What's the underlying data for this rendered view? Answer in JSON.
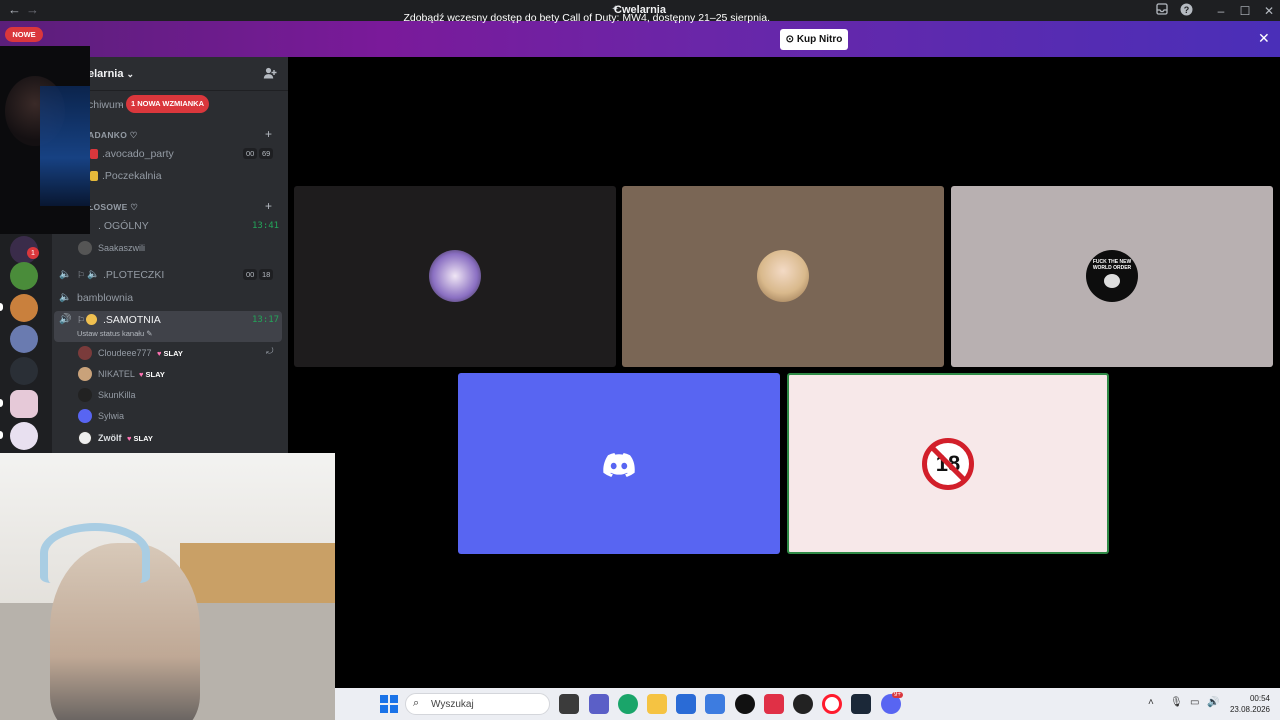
{
  "window": {
    "title": "Cwelarnia",
    "back_glyph": "←",
    "forward_glyph": "→",
    "icons": [
      "inbox-icon",
      "help-icon",
      "minimize-icon",
      "maximize-icon",
      "close-icon"
    ]
  },
  "banner": {
    "text": "Zdobądź wczesny dostęp do bety Call of Duty: MW4, dostępny 21–25 sierpnia.",
    "button_label": "Kup Nitro",
    "close_glyph": "✕"
  },
  "rail": {
    "new_badge": "NOWE",
    "unread_count": "1"
  },
  "server": {
    "name": "elarnia",
    "archive_label": "chiwum",
    "mention_badge": "1 NOWA WZMIANKA"
  },
  "categories": [
    {
      "name": "ADANKO ♡"
    },
    {
      "name": "ŁOSOWE ♡"
    }
  ],
  "channels": {
    "avocado": {
      "name": ".avocado_party",
      "count_a": "00",
      "count_b": "69"
    },
    "poczekalnia": {
      "name": ".Poczekalnia"
    },
    "ogolny": {
      "name": "OGÓLNY",
      "time": "13:41"
    },
    "ogolny_user": "Saakaszwili",
    "ploteczki": {
      "name": ".PLOTECZKI",
      "count_a": "00",
      "count_b": "18"
    },
    "bamblownia": {
      "name": "bamblownia"
    },
    "samotnia": {
      "name": ".SAMOTNIA",
      "time": "13:17",
      "status": "Ustaw status kanału"
    }
  },
  "voice_users": [
    {
      "name": "Cloudeee777",
      "tag": "SLAY"
    },
    {
      "name": "NIKATEL",
      "tag": "SLAY"
    },
    {
      "name": "SkunKilla",
      "tag": ""
    },
    {
      "name": "Sylwia",
      "tag": ""
    },
    {
      "name": "Zwölf",
      "tag": "SLAY"
    }
  ],
  "tiles": {
    "tile3_text": "FUCK THE NEW WORLD ORDER",
    "tile5_text": "18"
  },
  "taskbar": {
    "search_placeholder": "Wyszukaj",
    "time": "00:54",
    "date": "23.08.2026",
    "notification_badge": "9+"
  },
  "colors": {
    "accent": "#5865f2",
    "mention": "#da373c",
    "online": "#23a55a",
    "sidebar": "#2b2d31",
    "rail": "#1e1f22"
  }
}
